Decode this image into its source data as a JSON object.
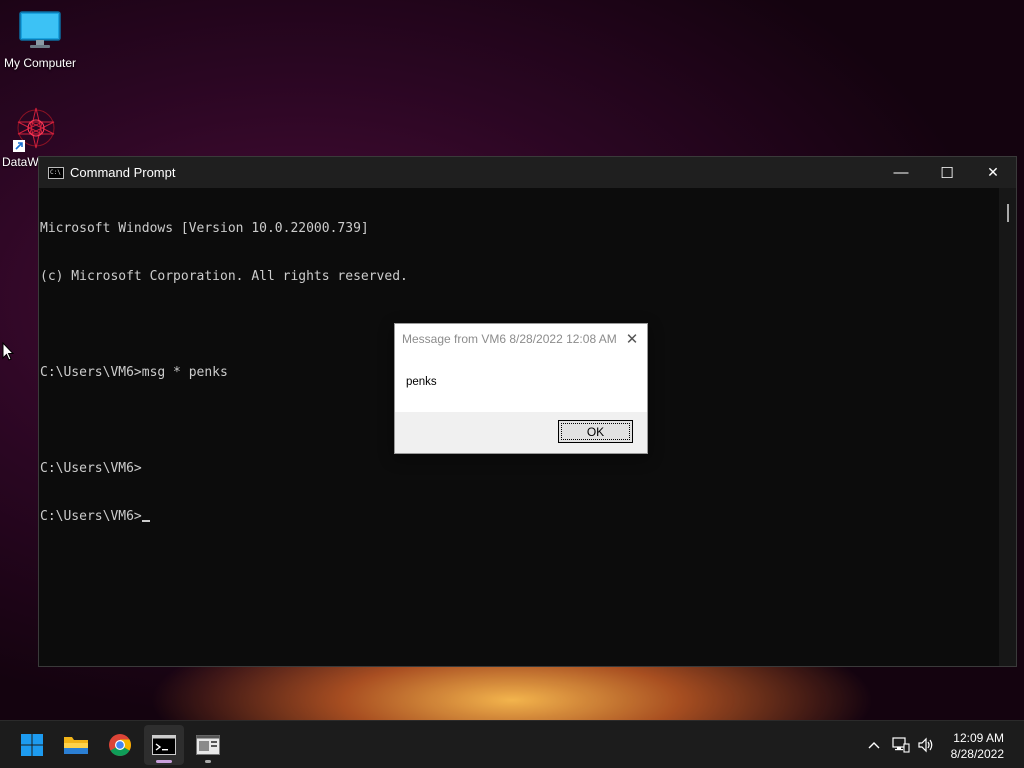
{
  "desktop": {
    "icons": [
      {
        "label": "My Computer",
        "icon": "monitor-icon"
      },
      {
        "label": "DataW",
        "icon": "datawrapper-shortcut-icon"
      }
    ]
  },
  "cmd": {
    "title": "Command Prompt",
    "lines": [
      "Microsoft Windows [Version 10.0.22000.739]",
      "(c) Microsoft Corporation. All rights reserved.",
      "",
      "C:\\Users\\VM6>msg * penks",
      "",
      "C:\\Users\\VM6>",
      "C:\\Users\\VM6>"
    ],
    "controls": {
      "minimize": "—",
      "maximize": "☐",
      "close": "✕"
    }
  },
  "message_box": {
    "title": "Message from VM6 8/28/2022 12:08 AM",
    "body": "penks",
    "ok_label": "OK",
    "close_glyph": "✕"
  },
  "taskbar": {
    "items": [
      {
        "name": "start-button",
        "icon": "windows-logo-icon"
      },
      {
        "name": "file-explorer",
        "icon": "folder-icon"
      },
      {
        "name": "chrome",
        "icon": "chrome-icon"
      },
      {
        "name": "command-prompt",
        "icon": "terminal-icon",
        "active": true
      },
      {
        "name": "app",
        "icon": "window-app-icon"
      }
    ],
    "tray": {
      "chevron": "^",
      "network": "network-icon",
      "volume": "volume-icon"
    },
    "clock": {
      "time": "12:09 AM",
      "date": "8/28/2022"
    }
  },
  "colors": {
    "console_bg": "#0c0c0c",
    "console_text": "#cccccc",
    "taskbar_bg": "#1c1c1c"
  }
}
